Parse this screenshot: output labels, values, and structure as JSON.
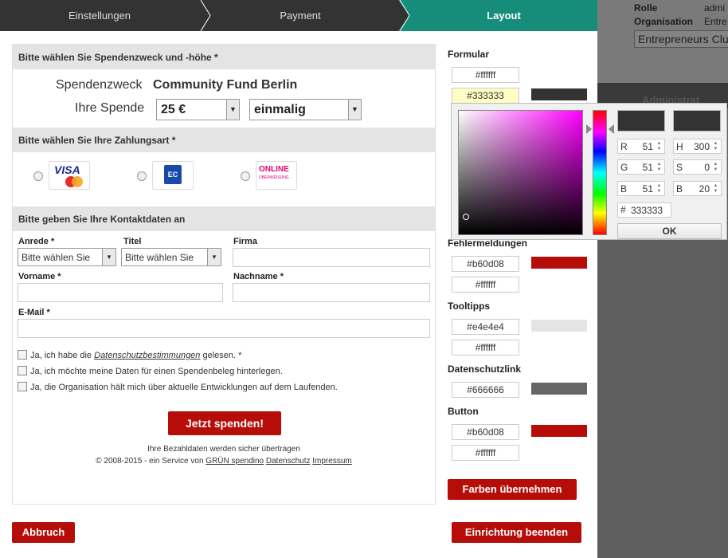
{
  "background": {
    "rows": [
      {
        "label": "Rolle",
        "value": "admi"
      },
      {
        "label": "Organisation",
        "value": "Entre"
      }
    ],
    "org_input": "Entrepreneurs Clu",
    "admin_label": "Administrat"
  },
  "steps": [
    {
      "label": "Einstellungen",
      "state": "done"
    },
    {
      "label": "Payment",
      "state": "done"
    },
    {
      "label": "Layout",
      "state": "active"
    }
  ],
  "preview": {
    "purpose_header": "Bitte wählen Sie Spendenzweck und -höhe *",
    "purpose_label": "Spendenzweck",
    "purpose_value": "Community Fund Berlin",
    "donation_label": "Ihre Spende",
    "amount_select": "25 €",
    "frequency_select": "einmalig",
    "payment_header": "Bitte wählen Sie Ihre Zahlungsart *",
    "payment_methods": [
      {
        "name": "visa-mastercard-logo",
        "text": "VISA"
      },
      {
        "name": "ec-lastschrift-logo",
        "text": "EC"
      },
      {
        "name": "online-ueberweisung-logo",
        "text": "ONLINE",
        "subtext": "ÜBERWEISUNG"
      }
    ],
    "contact_header": "Bitte geben Sie Ihre Kontaktdaten an",
    "fields": {
      "salutation_label": "Anrede *",
      "salutation_value": "Bitte wählen Sie",
      "title_label": "Titel",
      "title_value": "Bitte wählen Sie",
      "company_label": "Firma",
      "firstname_label": "Vorname *",
      "lastname_label": "Nachname *",
      "email_label": "E-Mail *"
    },
    "checkboxes": [
      {
        "prefix": "Ja, ich habe die ",
        "link": "Datenschutzbestimmungen",
        "suffix": " gelesen. *"
      },
      {
        "prefix": "Ja, ich möchte meine Daten für einen Spendenbeleg hinterlegen.",
        "link": "",
        "suffix": ""
      },
      {
        "prefix": "Ja, die Organisation hält mich über aktuelle Entwicklungen auf dem Laufenden.",
        "link": "",
        "suffix": ""
      }
    ],
    "donate_button": "Jetzt spenden!",
    "footer_secure": "Ihre Bezahldaten werden sicher übertragen",
    "footer_copyright": "© 2008-2015 - ein Service von ",
    "footer_link_service": "GRÜN spendino",
    "footer_link_privacy": "Datenschutz",
    "footer_link_imprint": "Impressum"
  },
  "colors": {
    "formular_label": "Formular",
    "formular_bg": "#ffffff",
    "formular_text": "#333333",
    "error_label": "Fehlermeldungen",
    "error_bg": "#b60d08",
    "error_text": "#ffffff",
    "tooltip_label": "Tooltipps",
    "tooltip_bg": "#e4e4e4",
    "tooltip_text": "#ffffff",
    "privacy_label": "Datenschutzlink",
    "privacy_value": "#666666",
    "button_label": "Button",
    "button_bg": "#b60d08",
    "button_text": "#ffffff",
    "apply_button": "Farben übernehmen"
  },
  "picker": {
    "r": "51",
    "g": "51",
    "b": "51",
    "h": "300",
    "s": "0",
    "v": "20",
    "hex": "333333",
    "ok": "OK",
    "current_color": "#333333"
  },
  "actions": {
    "cancel": "Abbruch",
    "finish": "Einrichtung beenden"
  }
}
